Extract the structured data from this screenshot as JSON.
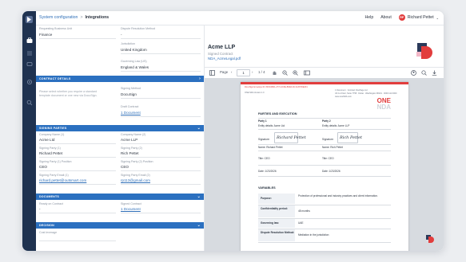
{
  "breadcrumb": {
    "parent": "System configuration",
    "separator": ">",
    "current": "Integrations"
  },
  "topnav": {
    "help": "Help",
    "about": "About",
    "avatar_initials": "RP",
    "user_name": "Richard Pettet",
    "user_chevron": "⌄"
  },
  "icons": {
    "rail": [
      "app-logo",
      "briefcase-icon",
      "list-icon",
      "chat-icon",
      "settings-icon",
      "search-icon"
    ],
    "viewer_toolbar": [
      "sidebar-toggle-icon",
      "hand-tool-icon",
      "zoom-out-icon",
      "zoom-in-icon",
      "fit-page-icon",
      "profile-icon",
      "search-icon",
      "download-icon"
    ]
  },
  "colors": {
    "rail": "#1f3250",
    "section_header": "#2b70c0",
    "link": "#2f6fb8",
    "brand_red": "#e23d3d"
  },
  "form": {
    "top": {
      "requesting_bu_label": "Requesting Business Unit",
      "requesting_bu_value": "Finance",
      "dispute_method_label": "Dispute Resolution Method",
      "dispute_method_value": "-",
      "jurisdiction_label": "Jurisdiction",
      "jurisdiction_value": "United Kingdom",
      "governing_law_label": "Governing Law (US)",
      "governing_law_value": "England & Wales"
    },
    "contract_details": {
      "header": "CONTRACT DETAILS",
      "chevron": "›",
      "note_line1": "Please select whether you require a standard",
      "note_line2": "template document or one new via DocuSign.",
      "signing_method_label": "Signing Method",
      "signing_method_value": "DocuSign",
      "draft_contract_label": "Draft Contract",
      "draft_contract_value": "1 Document"
    },
    "signing_parties": {
      "header": "SIGNING PARTIES",
      "chevron": "⌄",
      "company1_label": "Company Name (1)",
      "company1_value": "Acme Ltd",
      "company2_label": "Company Name (2)",
      "company2_value": "Acme LLP",
      "party1_label": "Signing Party (1)",
      "party1_value": "Richard Pettet",
      "party2_label": "Signing Party (2)",
      "party2_value": "Rich Pettet",
      "pos1_label": "Signing Party (1) Position",
      "pos1_value": "CEO",
      "pos2_label": "Signing Party (2) Position",
      "pos2_value": "CEO",
      "email1_label": "Signing Party Email (1)",
      "email1_value": "richard.pettet@outsmart.com",
      "email2_label": "Signing Party Email (2)",
      "email2_value": "rp113@gmail.com"
    },
    "documents": {
      "header": "DOCUMENTS",
      "chevron": "⌄",
      "ready_label": "Ready on Contract",
      "ready_value": "-",
      "signed_label": "Signed Contract",
      "signed_value": "1 Document"
    },
    "decision": {
      "header": "DECISION",
      "chevron": "⌄",
      "cost_label": "Cost leverage"
    }
  },
  "document": {
    "title": "Acme LLP",
    "subtitle": "Signed Contract",
    "filename": "NDA_AcmeLegal.pdf",
    "toolbar": {
      "page_label": "Page",
      "prev": "‹",
      "page_number": "1",
      "next": "›",
      "page_count": "1 / 4"
    },
    "pdf": {
      "envelope_id": "DocuSign Envelope ID: 8F6C2B01-2774-4C3E-B9DA-6C1CA57DE2F1",
      "header_left": "ONE NDA Version 1.0",
      "header_right_line1": "1 Document · Contract OnePage Ltd",
      "header_right_line2": "UK 1st Floor, Suite 7758 · Dubai · Washington 98101 · 0000 111 0000",
      "header_right_line3": "www.oneNDA.com",
      "logo_a": "ONE",
      "logo_b": "NDA",
      "parties_heading": "PARTIES AND EXECUTION",
      "party1_heading": "Party 1",
      "party1_entity": "Entity details: Acme Ltd",
      "party2_heading": "Party 2",
      "party2_entity": "Entity details: Acme LLP",
      "signature_label": "Signature:",
      "sig1": "Richard Pettet",
      "sig2": "Rich Pettet",
      "name1": "Name: Richard Pettet",
      "name2": "Name: Rich Pettet",
      "title1": "Title: CEO",
      "title2": "Title: CEO",
      "date1": "Date: 1/23/2026",
      "date2": "Date: 1/23/2026",
      "variables_heading": "VARIABLES",
      "variables": [
        {
          "label": "Purpose:",
          "value": "Protection of professional and industry practices and client information."
        },
        {
          "label": "Confidentiality period:",
          "value": "48 months"
        },
        {
          "label": "Governing law:",
          "value": "UAE"
        },
        {
          "label": "Dispute Resolution Method:",
          "value": "Mediation in the jurisdiction"
        }
      ]
    }
  }
}
